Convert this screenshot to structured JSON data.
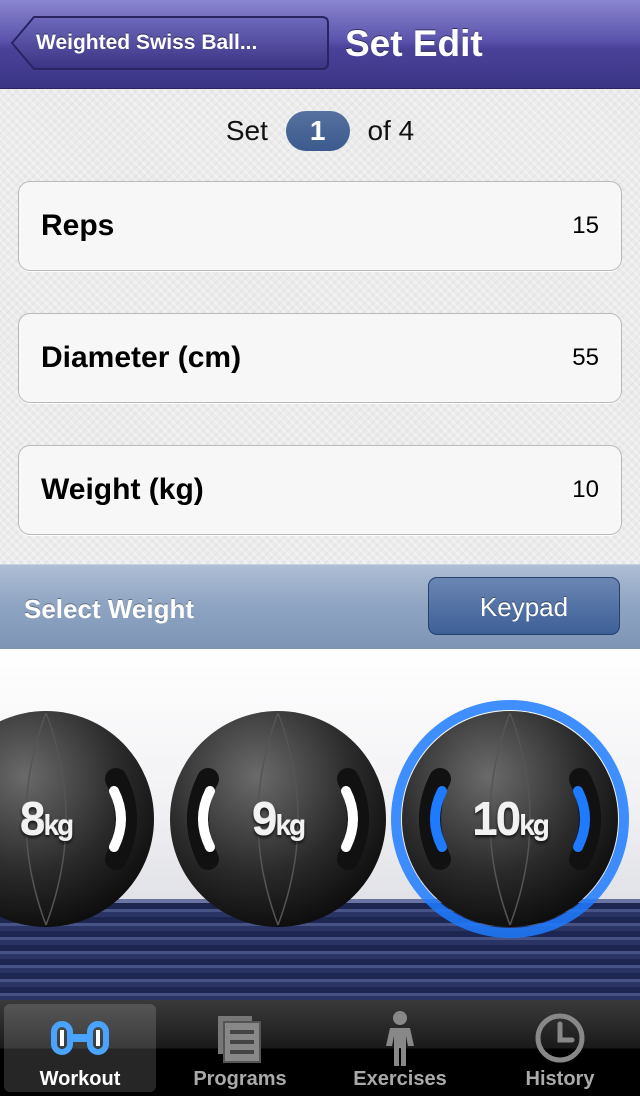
{
  "nav": {
    "back_label": "Weighted Swiss Ball...",
    "title": "Set Edit"
  },
  "set_indicator": {
    "prefix": "Set",
    "current": "1",
    "suffix": "of 4"
  },
  "fields": [
    {
      "label": "Reps",
      "value": "15"
    },
    {
      "label": "Diameter (cm)",
      "value": "55"
    },
    {
      "label": "Weight (kg)",
      "value": "10"
    }
  ],
  "weight_selector": {
    "label": "Select Weight",
    "keypad_label": "Keypad",
    "balls": [
      {
        "value": "8",
        "unit": "kg",
        "selected": false
      },
      {
        "value": "9",
        "unit": "kg",
        "selected": false
      },
      {
        "value": "10",
        "unit": "kg",
        "selected": true
      }
    ]
  },
  "tabs": [
    {
      "label": "Workout",
      "icon": "workout-icon",
      "active": true
    },
    {
      "label": "Programs",
      "icon": "programs-icon",
      "active": false
    },
    {
      "label": "Exercises",
      "icon": "exercises-icon",
      "active": false
    },
    {
      "label": "History",
      "icon": "history-icon",
      "active": false
    }
  ],
  "colors": {
    "nav": "#5c55ad",
    "selected_glow": "#1e7bff",
    "pill": "#3c5a8e"
  }
}
